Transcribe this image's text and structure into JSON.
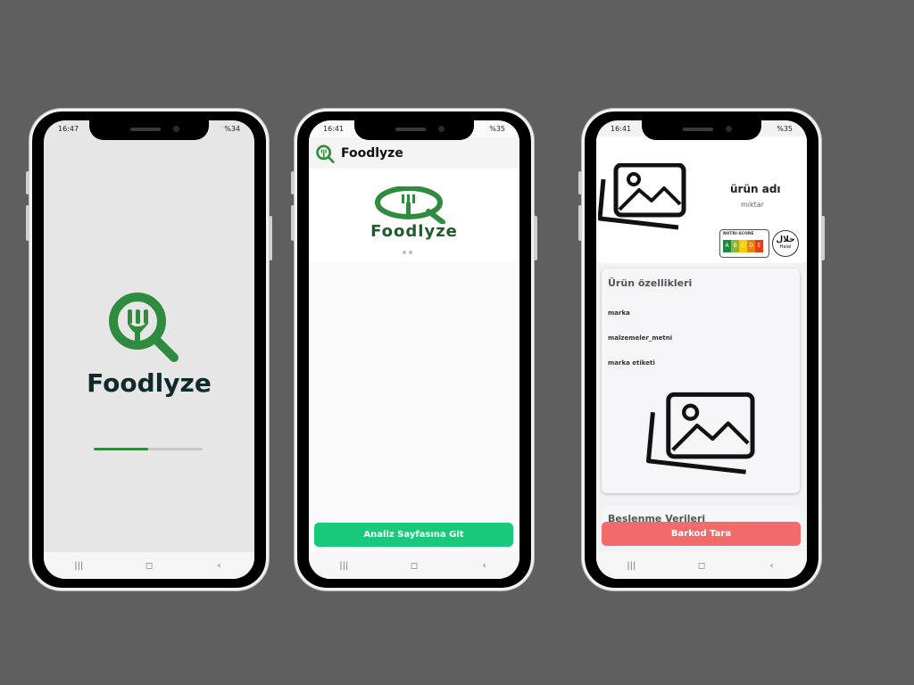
{
  "colors": {
    "brand_green": "#2f8b3d",
    "button_green": "#19c97b",
    "button_red": "#f26b6b"
  },
  "splash": {
    "status_time": "16:47",
    "status_battery": "%34",
    "app_name": "Foodlyze",
    "loading_progress": 0.5
  },
  "home": {
    "status_time": "16:41",
    "status_battery": "%35",
    "appbar_title": "Foodlyze",
    "banner_word": "Foodlyze",
    "action_button": "Analiz Sayfasına Git"
  },
  "product": {
    "status_time": "16:41",
    "status_battery": "%35",
    "product_name": "ürün adı",
    "quantity": "miktar",
    "nutri_score_label": "NUTRI-SCORE",
    "nutri_grades": [
      "A",
      "B",
      "C",
      "D",
      "E"
    ],
    "halal_label": "Halal",
    "features_title": "Ürün özellikleri",
    "feature_rows": [
      "marka",
      "malzemeler_metni",
      "marka etiketi"
    ],
    "nutrition_title": "Beslenme Verileri",
    "scan_button": "Barkod Tara"
  },
  "navbar": {
    "recents_icon": "|||",
    "home_icon": "◻",
    "back_icon": "‹"
  }
}
